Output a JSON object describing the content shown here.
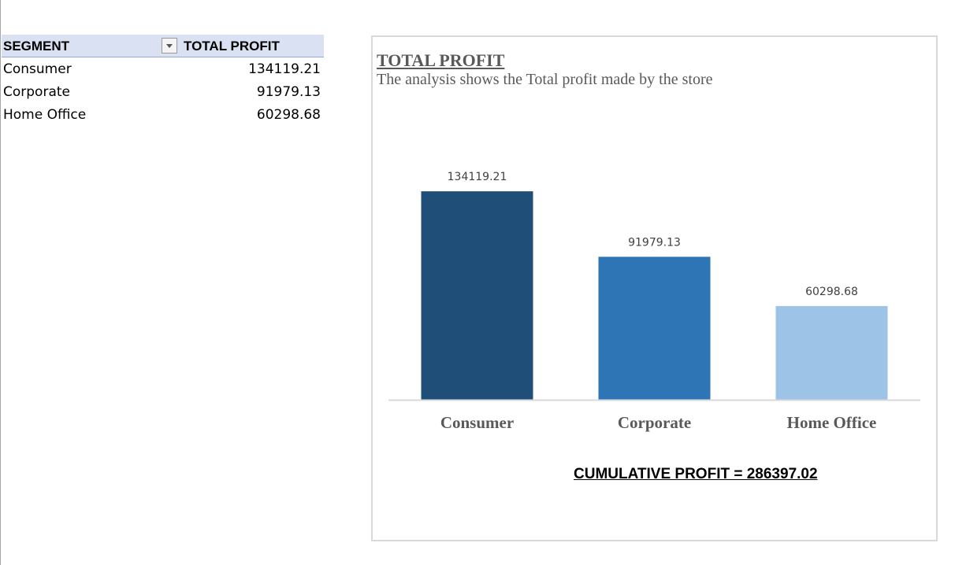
{
  "pivot": {
    "header": {
      "segment": "SEGMENT",
      "total_profit": "TOTAL PROFIT"
    },
    "filter_icon": "filter-dropdown-icon",
    "rows": [
      {
        "label": "Consumer",
        "value": "134119.21"
      },
      {
        "label": "Corporate",
        "value": "91979.13"
      },
      {
        "label": "Home Office",
        "value": "60298.68"
      }
    ]
  },
  "chart": {
    "title": "TOTAL PROFIT",
    "subtitle": "The analysis shows the Total profit made by the store",
    "footer": "CUMULATIVE PROFIT = 286397.02"
  },
  "chart_data": {
    "type": "bar",
    "title": "TOTAL PROFIT",
    "subtitle": "The analysis shows the Total profit made by the store",
    "categories": [
      "Consumer",
      "Corporate",
      "Home Office"
    ],
    "values": [
      134119.21,
      91979.13,
      60298.68
    ],
    "data_labels": [
      "134119.21",
      "91979.13",
      "60298.68"
    ],
    "colors": [
      "#1f4e79",
      "#2e75b6",
      "#9dc3e6"
    ],
    "ylim": [
      0,
      160000
    ],
    "y_axis_visible": false,
    "grid": false,
    "legend": "none"
  }
}
